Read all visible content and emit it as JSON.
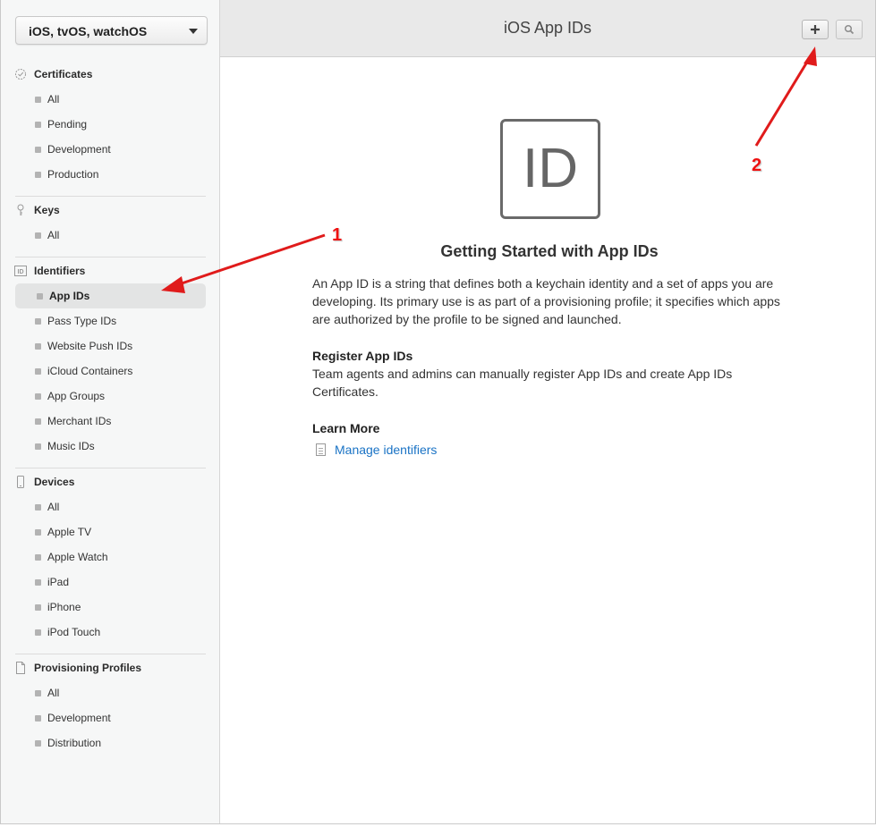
{
  "platform_select": {
    "value": "iOS, tvOS, watchOS"
  },
  "sidebar": {
    "certificates": {
      "title": "Certificates",
      "items": [
        "All",
        "Pending",
        "Development",
        "Production"
      ]
    },
    "keys": {
      "title": "Keys",
      "items": [
        "All"
      ]
    },
    "identifiers": {
      "title": "Identifiers",
      "items": [
        "App IDs",
        "Pass Type IDs",
        "Website Push IDs",
        "iCloud Containers",
        "App Groups",
        "Merchant IDs",
        "Music IDs"
      ]
    },
    "devices": {
      "title": "Devices",
      "items": [
        "All",
        "Apple TV",
        "Apple Watch",
        "iPad",
        "iPhone",
        "iPod Touch"
      ]
    },
    "profiles": {
      "title": "Provisioning Profiles",
      "items": [
        "All",
        "Development",
        "Distribution"
      ]
    }
  },
  "header": {
    "title": "iOS App IDs"
  },
  "main": {
    "icon_text": "ID",
    "heading": "Getting Started with App IDs",
    "intro": "An App ID is a string that defines both a keychain identity and a set of apps you are developing. Its primary use is as part of a provisioning profile; it specifies which apps are authorized by the profile to be signed and launched.",
    "register_title": "Register App IDs",
    "register_text": "Team agents and admins can manually register App IDs and create App IDs Certificates.",
    "learn_title": "Learn More",
    "learn_link": "Manage identifiers"
  },
  "annotations": {
    "one": "1",
    "two": "2",
    "color": "#e01b1b"
  }
}
